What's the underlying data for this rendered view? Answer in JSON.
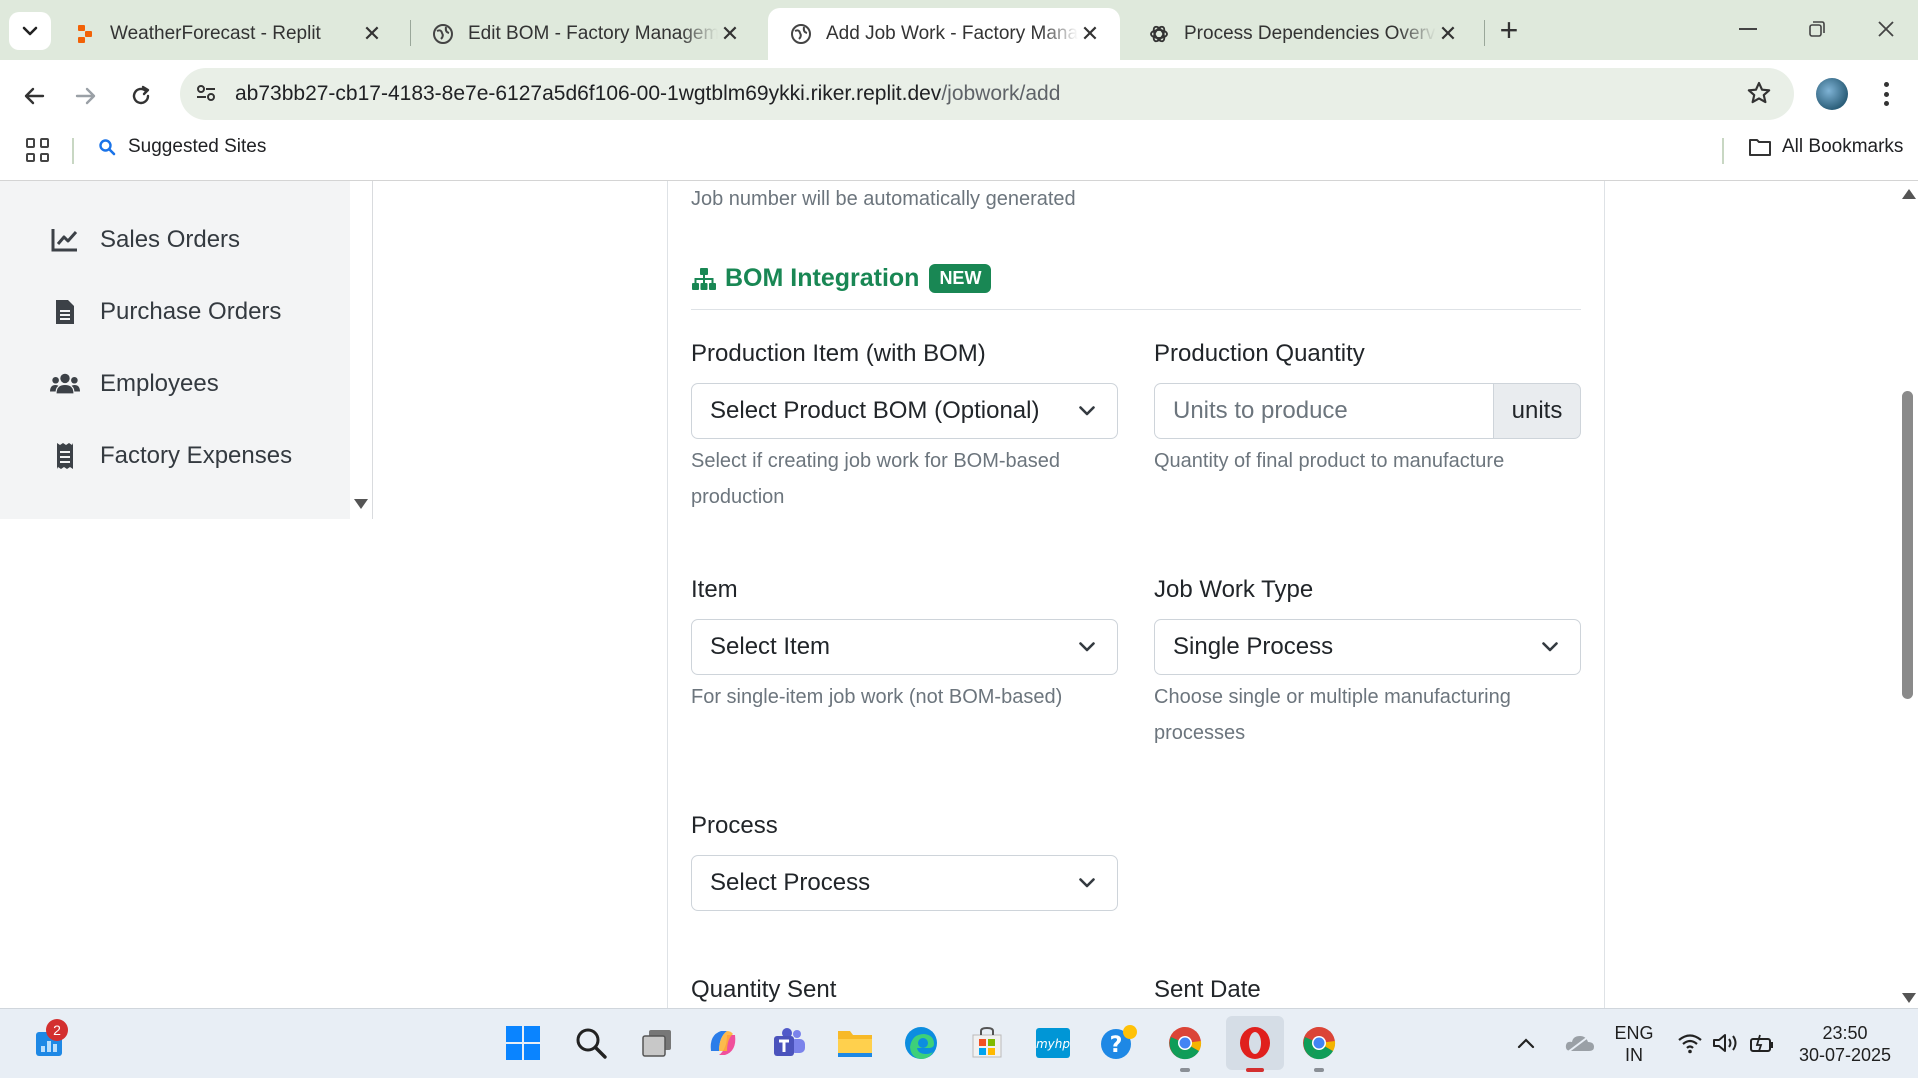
{
  "browser": {
    "tabs": [
      {
        "title": "WeatherForecast - Replit",
        "active": false,
        "favicon": "replit-icon"
      },
      {
        "title": "Edit BOM - Factory Management",
        "active": false,
        "favicon": "globe-icon"
      },
      {
        "title": "Add Job Work - Factory Management",
        "active": true,
        "favicon": "globe-icon"
      },
      {
        "title": "Process Dependencies Overview",
        "active": false,
        "favicon": "openai-icon"
      }
    ],
    "url_host": "ab73bb27-cb17-4183-8e7e-6127a5d6f106-00-1wgtblm69ykki.riker.replit.dev",
    "url_path": "/jobwork/add",
    "bookmarks": {
      "suggested": "Suggested Sites",
      "all": "All Bookmarks"
    }
  },
  "sidebar": {
    "items": [
      {
        "label": "Sales Orders",
        "icon": "chart-line-icon"
      },
      {
        "label": "Purchase Orders",
        "icon": "file-invoice-icon"
      },
      {
        "label": "Employees",
        "icon": "users-icon"
      },
      {
        "label": "Factory Expenses",
        "icon": "receipt-icon"
      }
    ]
  },
  "form": {
    "job_number_help": "Job number will be automatically generated",
    "bom_section": {
      "title": "BOM Integration",
      "badge": "NEW",
      "icon": "sitemap-icon"
    },
    "production_item": {
      "label": "Production Item (with BOM)",
      "selected": "Select Product BOM (Optional)",
      "help": "Select if creating job work for BOM-based production"
    },
    "production_quantity": {
      "label": "Production Quantity",
      "placeholder": "Units to produce",
      "addon": "units",
      "help": "Quantity of final product to manufacture"
    },
    "item": {
      "label": "Item",
      "selected": "Select Item",
      "help": "For single-item job work (not BOM-based)"
    },
    "job_work_type": {
      "label": "Job Work Type",
      "selected": "Single Process",
      "help": "Choose single or multiple manufacturing processes"
    },
    "process": {
      "label": "Process",
      "selected": "Select Process"
    },
    "quantity_sent": {
      "label": "Quantity Sent"
    },
    "sent_date": {
      "label": "Sent Date"
    }
  },
  "taskbar": {
    "notification_count": "2",
    "language": "ENG",
    "region": "IN",
    "time": "23:50",
    "date": "30-07-2025"
  },
  "colors": {
    "accent_green": "#198754",
    "chrome_bg": "#dfe9dc"
  }
}
